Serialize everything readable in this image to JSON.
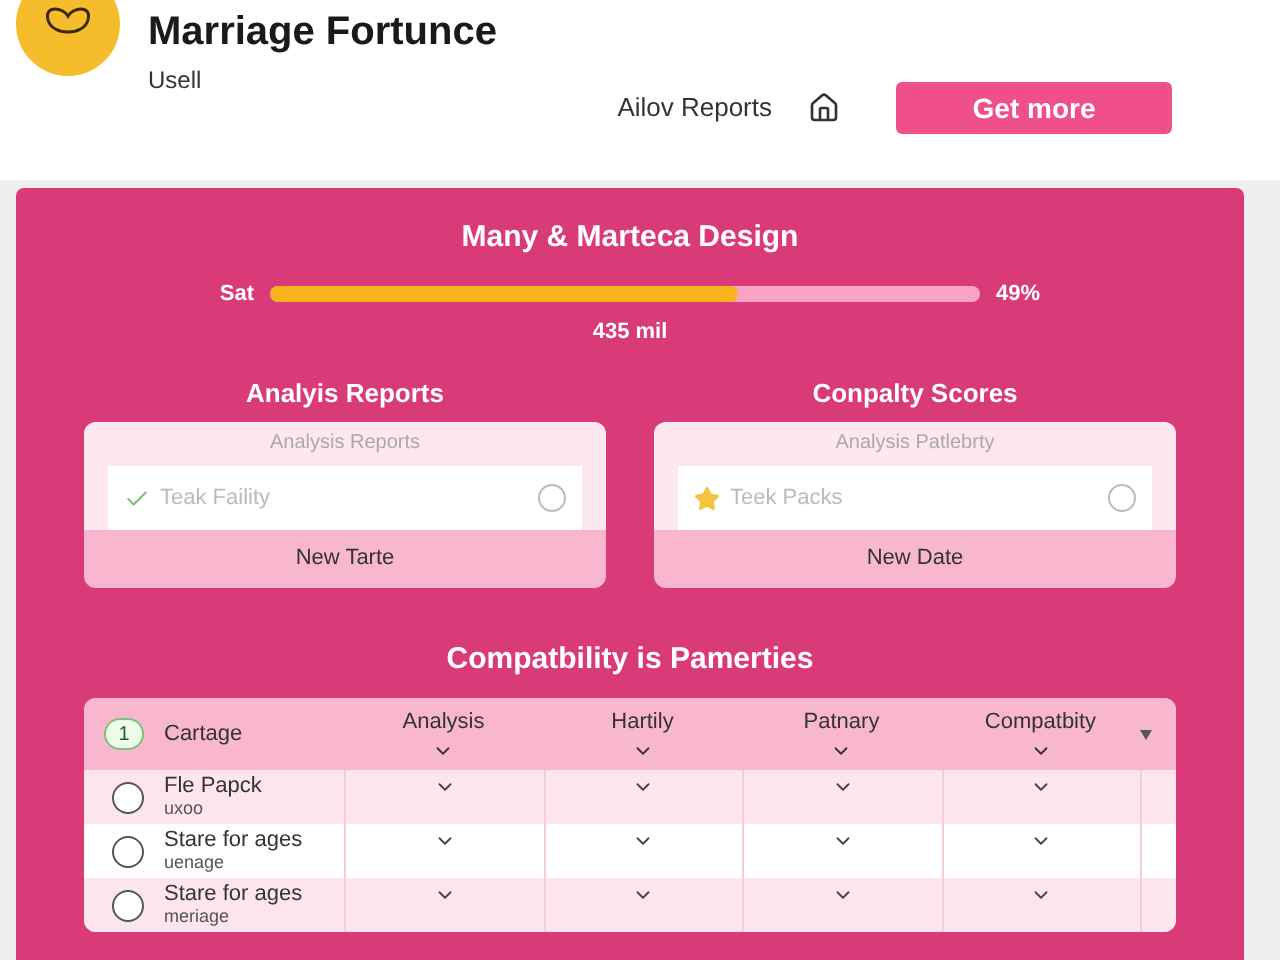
{
  "header": {
    "title": "Marriage Fortunce",
    "subtitle": "Usell",
    "nav_link": "Ailov Reports",
    "button": "Get more"
  },
  "panel": {
    "title": "Many & Marteca Design",
    "progress": {
      "label": "Sat",
      "level": 0.66,
      "reading": "49%",
      "caption": "435 mil"
    },
    "cards": [
      {
        "heading": "Analyis Reports",
        "title": "Analysis Reports",
        "item": {
          "kind": "check",
          "label": "Teak Faility",
          "selected": false
        },
        "footer": "New Tarte"
      },
      {
        "heading": "Conpalty Scores",
        "title": "Analysis Patlebrty",
        "item": {
          "kind": "star",
          "label": "Teek Packs",
          "selected": false
        },
        "footer": "New Date"
      }
    ],
    "table": {
      "title": "Compatbility is Pamerties",
      "badge": "1",
      "first_column": "Cartage",
      "columns": [
        "Analysis",
        "Hartily",
        "Patnary",
        "Compatbity"
      ],
      "rows": [
        {
          "label": "Fle Papck",
          "sub": "uxoo",
          "selected": false
        },
        {
          "label": "Stare for ages",
          "sub": "uenage",
          "selected": false
        },
        {
          "label": "Stare for ages",
          "sub": "meriage",
          "selected": false
        }
      ]
    }
  }
}
